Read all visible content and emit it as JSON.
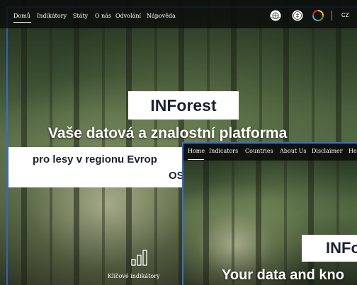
{
  "cz": {
    "nav": {
      "items": [
        "Domů",
        "Indikátory",
        "Státy",
        "O nás",
        "Odvolání",
        "Nápověda"
      ],
      "lang": "CZ"
    },
    "brand": "INForest",
    "headline": "Vaše datová a znalostní platforma",
    "subhead_line1": "pro lesy v regionu Evrop",
    "subhead_line2": "OS",
    "indicators_label": "Klíčové indikátory"
  },
  "en": {
    "nav": {
      "items": [
        "Home",
        "Indicators",
        "Countries",
        "About Us",
        "Disclaimer",
        "He"
      ]
    },
    "brand": "INFo",
    "headline": "Your data and kno"
  },
  "colors": {
    "accent_border": "#3b6fd0"
  },
  "icons": [
    "un-emblem-icon",
    "fao-icon",
    "sdg-wheel-icon",
    "bar-chart-icon"
  ]
}
